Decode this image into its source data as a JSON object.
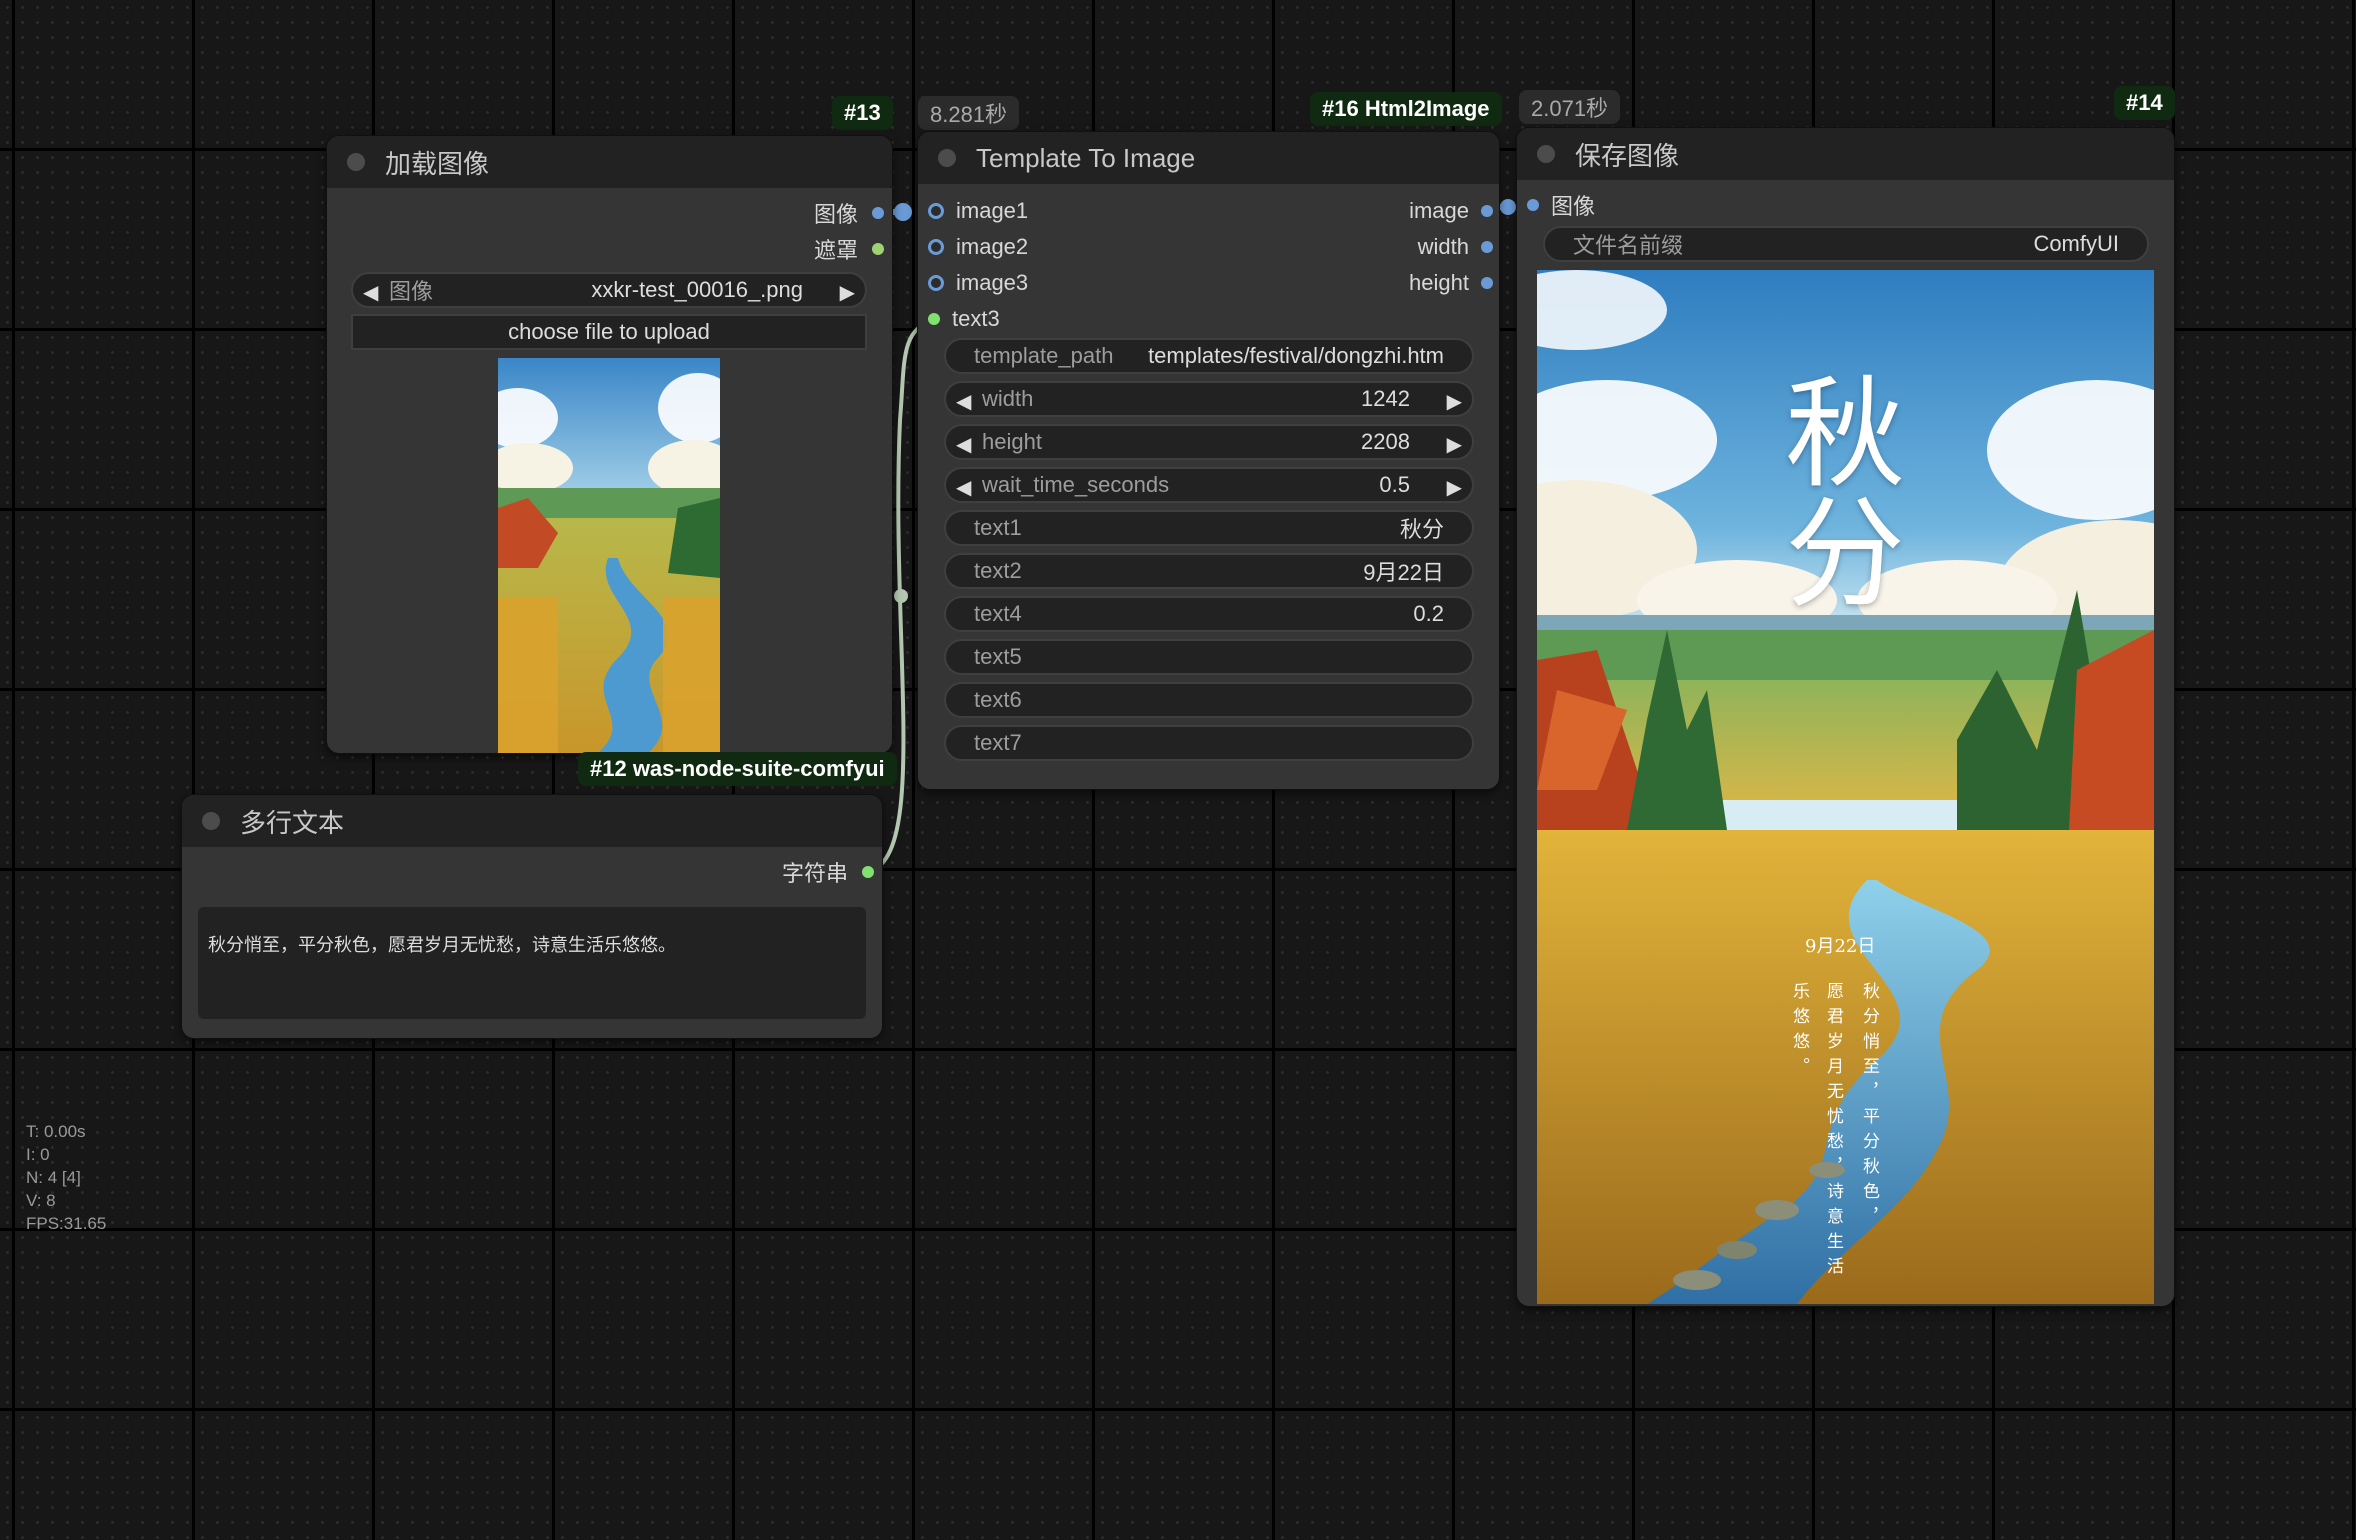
{
  "nodes": {
    "load_image": {
      "title": "加载图像",
      "id_badge": "#13",
      "outputs": [
        "图像",
        "遮罩"
      ],
      "image_widget": {
        "label": "图像",
        "value": "xxkr-test_00016_.png"
      },
      "upload_label": "choose file to upload",
      "source_badge": "#12 was-node-suite-comfyui"
    },
    "multiline_text": {
      "title": "多行文本",
      "output": "字符串",
      "text": "秋分悄至，平分秋色，愿君岁月无忧愁，诗意生活乐悠悠。"
    },
    "template_to_image": {
      "title": "Template To Image",
      "time": "8.281秒",
      "id_badge": "#16 Html2Image",
      "inputs": [
        "image1",
        "image2",
        "image3",
        "text3"
      ],
      "outputs": [
        "image",
        "width",
        "height"
      ],
      "widgets": [
        {
          "label": "template_path",
          "value": "templates/festival/dongzhi.htm",
          "arrows": false
        },
        {
          "label": "width",
          "value": "1242",
          "arrows": true
        },
        {
          "label": "height",
          "value": "2208",
          "arrows": true
        },
        {
          "label": "wait_time_seconds",
          "value": "0.5",
          "arrows": true
        },
        {
          "label": "text1",
          "value": "秋分",
          "arrows": false
        },
        {
          "label": "text2",
          "value": "9月22日",
          "arrows": false
        },
        {
          "label": "text4",
          "value": "0.2",
          "arrows": false
        },
        {
          "label": "text5",
          "value": "",
          "arrows": false
        },
        {
          "label": "text6",
          "value": "",
          "arrows": false
        },
        {
          "label": "text7",
          "value": "",
          "arrows": false
        }
      ]
    },
    "save_image": {
      "title": "保存图像",
      "time": "2.071秒",
      "id_badge": "#14",
      "input": "图像",
      "filename_prefix": {
        "label": "文件名前缀",
        "value": "ComfyUI"
      },
      "poster": {
        "title": "秋分",
        "date": "9月22日",
        "poem_columns": [
          "秋分悄至，平分秋色，",
          "愿君岁月无忧愁，诗意生活",
          "乐悠悠。"
        ]
      }
    }
  },
  "stats": [
    "T: 0.00s",
    "I: 0",
    "N: 4 [4]",
    "V: 8",
    "FPS:31.65"
  ],
  "colors": {
    "canvas": "#171717",
    "node_body": "#353535",
    "node_title": "#222222",
    "badge": "#0f2a10",
    "image_slot": "#6a9bd6",
    "string_slot": "#80e070",
    "link": "#b4c7b0"
  }
}
